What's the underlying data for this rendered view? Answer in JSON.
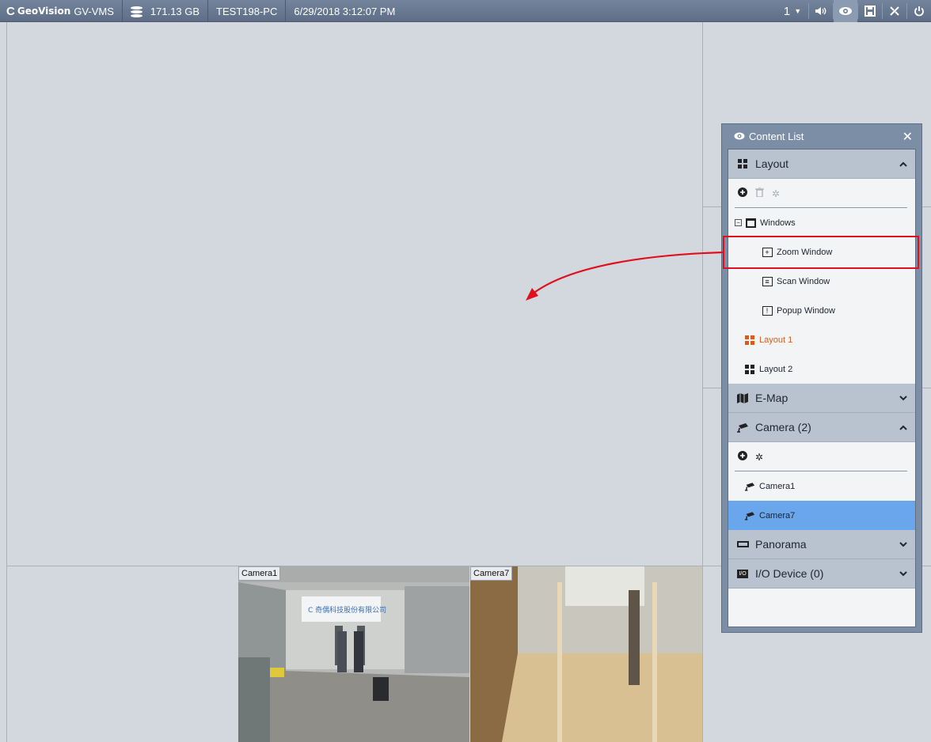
{
  "topbar": {
    "brand": "GeoVision",
    "product": "GV-VMS",
    "storage": "171.13 GB",
    "host": "TEST198-PC",
    "datetime": "6/29/2018 3:12:07 PM",
    "monitor_select": "1"
  },
  "panel": {
    "title": "Content List",
    "sections": {
      "layout": {
        "label": "Layout",
        "tree_root": "Windows",
        "windows": [
          "Zoom Window",
          "Scan Window",
          "Popup Window"
        ],
        "layouts": [
          "Layout 1",
          "Layout 2"
        ]
      },
      "emap": {
        "label": "E-Map"
      },
      "camera": {
        "label": "Camera (2)",
        "items": [
          "Camera1",
          "Camera7"
        ]
      },
      "panorama": {
        "label": "Panorama"
      },
      "io": {
        "label": "I/O Device (0)",
        "badge": "I/O"
      }
    }
  },
  "views": {
    "cam1": "Camera1",
    "cam7": "Camera7"
  },
  "colors": {
    "accent_orange": "#e15a13",
    "selected_blue": "#6aa6ec",
    "annotation_red": "#e0101c"
  }
}
